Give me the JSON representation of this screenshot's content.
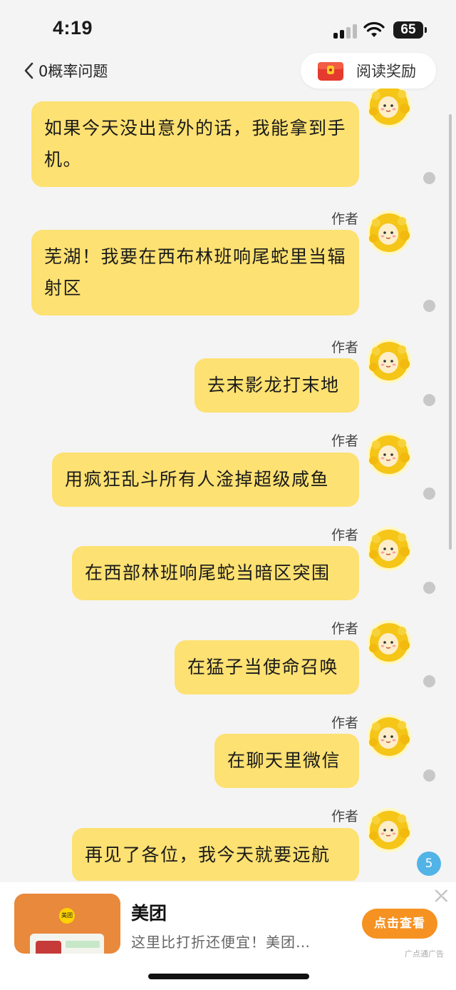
{
  "status_bar": {
    "time": "4:19",
    "battery": "65"
  },
  "nav": {
    "back_label": "0概率问题",
    "reward_label": "阅读奖励"
  },
  "messages": [
    {
      "author": "",
      "text": "如果今天没出意外的话，我能拿到手机。"
    },
    {
      "author": "作者",
      "text": "芜湖！我要在西布林班响尾蛇里当辐射区"
    },
    {
      "author": "作者",
      "text": "去末影龙打末地"
    },
    {
      "author": "作者",
      "text": "用疯狂乱斗所有人淦掉超级咸鱼"
    },
    {
      "author": "作者",
      "text": "在西部林班响尾蛇当暗区突围"
    },
    {
      "author": "作者",
      "text": "在猛子当使命召唤"
    },
    {
      "author": "作者",
      "text": "在聊天里微信"
    },
    {
      "author": "作者",
      "text": "再见了各位，我今天就要远航"
    }
  ],
  "unread_count": "5",
  "ad": {
    "thumb_logo": "美团",
    "title": "美团",
    "description": "这里比打折还便宜！美团…",
    "button_label": "点击查看",
    "source": "广点通广告"
  },
  "colors": {
    "bubble": "#fde172",
    "background": "#f4f4f4",
    "ad_button": "#f59221",
    "badge": "#51b3e6"
  }
}
